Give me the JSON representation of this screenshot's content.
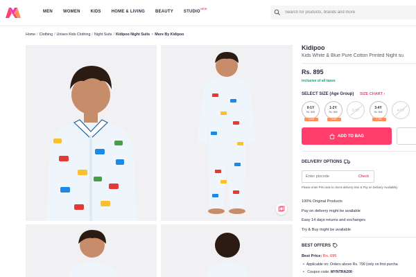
{
  "header": {
    "nav": [
      "MEN",
      "WOMEN",
      "KIDS",
      "HOME & LIVING",
      "BEAUTY",
      "STUDIO"
    ],
    "studio_badge": "NEW",
    "search_placeholder": "Search for products, brands and more",
    "brand_color": "#ff3f6c"
  },
  "breadcrumb": [
    "Home",
    "Clothing",
    "Unisex Kids Clothing",
    "Night Suits",
    "Kidipoo Night Suits",
    "More By Kidipoo"
  ],
  "product": {
    "brand": "Kidipoo",
    "name": "Kids White & Blue Pure Cotton Printed Night su",
    "price": "Rs. 895",
    "tax_note": "inclusive of all taxes"
  },
  "size_section": {
    "heading": "SELECT SIZE (Age Group)",
    "chart_link": "SIZE CHART",
    "sizes": [
      {
        "label": "0-1Y",
        "price": "Rs. 895",
        "left": "4 left",
        "available": true
      },
      {
        "label": "1-2Y",
        "price": "Rs. 895",
        "left": "3 left",
        "available": true
      },
      {
        "label": "2-3Y",
        "price": "",
        "left": "",
        "available": false
      },
      {
        "label": "3-4Y",
        "price": "Rs. 895",
        "left": "1 left",
        "available": true
      },
      {
        "label": "4-5Y",
        "price": "",
        "left": "",
        "available": false
      }
    ]
  },
  "actions": {
    "add_to_bag": "ADD TO BAG"
  },
  "delivery": {
    "heading": "DELIVERY OPTIONS",
    "pin_placeholder": "Enter pincode",
    "check": "Check",
    "note": "Please enter PIN code to check delivery time & Pay on Delivery Availability"
  },
  "features": [
    "100% Original Products",
    "Pay on delivery might be available",
    "Easy 14 days returns and exchanges",
    "Try & Buy might be available"
  ],
  "offers": {
    "heading": "BEST OFFERS",
    "best_price_label": "Best Price:",
    "best_price_value": "Rs. 695",
    "line1": "Applicable on: Orders above Rs. 799 (only on first purcha",
    "line2_label": "Coupon code:",
    "line2_value": "MYNTRA200"
  },
  "icons": [
    "search-icon",
    "truck-icon",
    "tag-icon",
    "bag-icon",
    "similar-icon"
  ]
}
